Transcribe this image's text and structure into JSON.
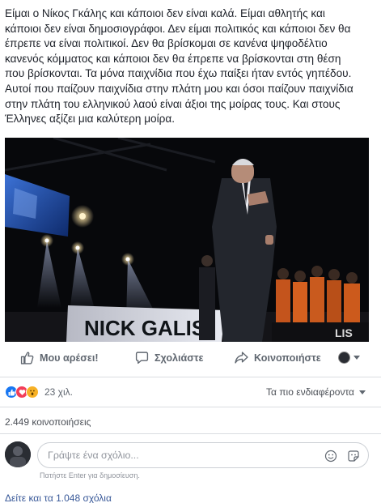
{
  "post": {
    "lines": [
      "Είμαι ο Νίκος Γκάλης και κάποιοι δεν είναι καλά. Είμαι αθλητής και",
      "κάποιοι δεν είναι δημοσιογράφοι. Δεν είμαι πολιτικός και κάποιοι δεν θα",
      "έπρεπε να είναι πολιτικοί. Δεν θα βρίσκομαι σε κανένα ψηφοδέλτιο",
      "κανενός κόμματος και κάποιοι δεν θα έπρεπε να βρίσκονται στη θέση",
      "που βρίσκονται. Τα μόνα παιχνίδια που έχω παίξει ήταν εντός γηπέδου.",
      "Αυτοί που παίζουν παιχνίδια στην πλάτη μου και όσοι παίζουν παιχνίδια",
      "στην πλάτη του ελληνικού λαού είναι άξιοι της μοίρας τους. Και στους",
      "Έλληνες αξίζει μια καλύτερη μοίρα."
    ]
  },
  "photo": {
    "banner_text": "NICK GALIS",
    "jersey_text": "LIS"
  },
  "actions": {
    "like": "Μου αρέσει!",
    "comment": "Σχολιάστε",
    "share": "Κοινοποιήστε"
  },
  "reactions": {
    "icons": [
      "like-icon",
      "love-icon",
      "wow-icon"
    ],
    "count": "23 χιλ.",
    "sort_label": "Τα πιο ενδιαφέροντα"
  },
  "shares": {
    "label": "2.449 κοινοποιήσεις"
  },
  "comment_box": {
    "placeholder": "Γράψτε ένα σχόλιο...",
    "hint": "Πατήστε Enter για δημοσίευση."
  },
  "view_comments": {
    "label": "Δείτε και τα 1.048 σχόλια"
  },
  "colors": {
    "text": "#1d2129",
    "muted": "#606770",
    "link": "#385898",
    "like_blue": "#1877f2",
    "love_red": "#f33e58",
    "wow_yellow": "#f7b125"
  }
}
